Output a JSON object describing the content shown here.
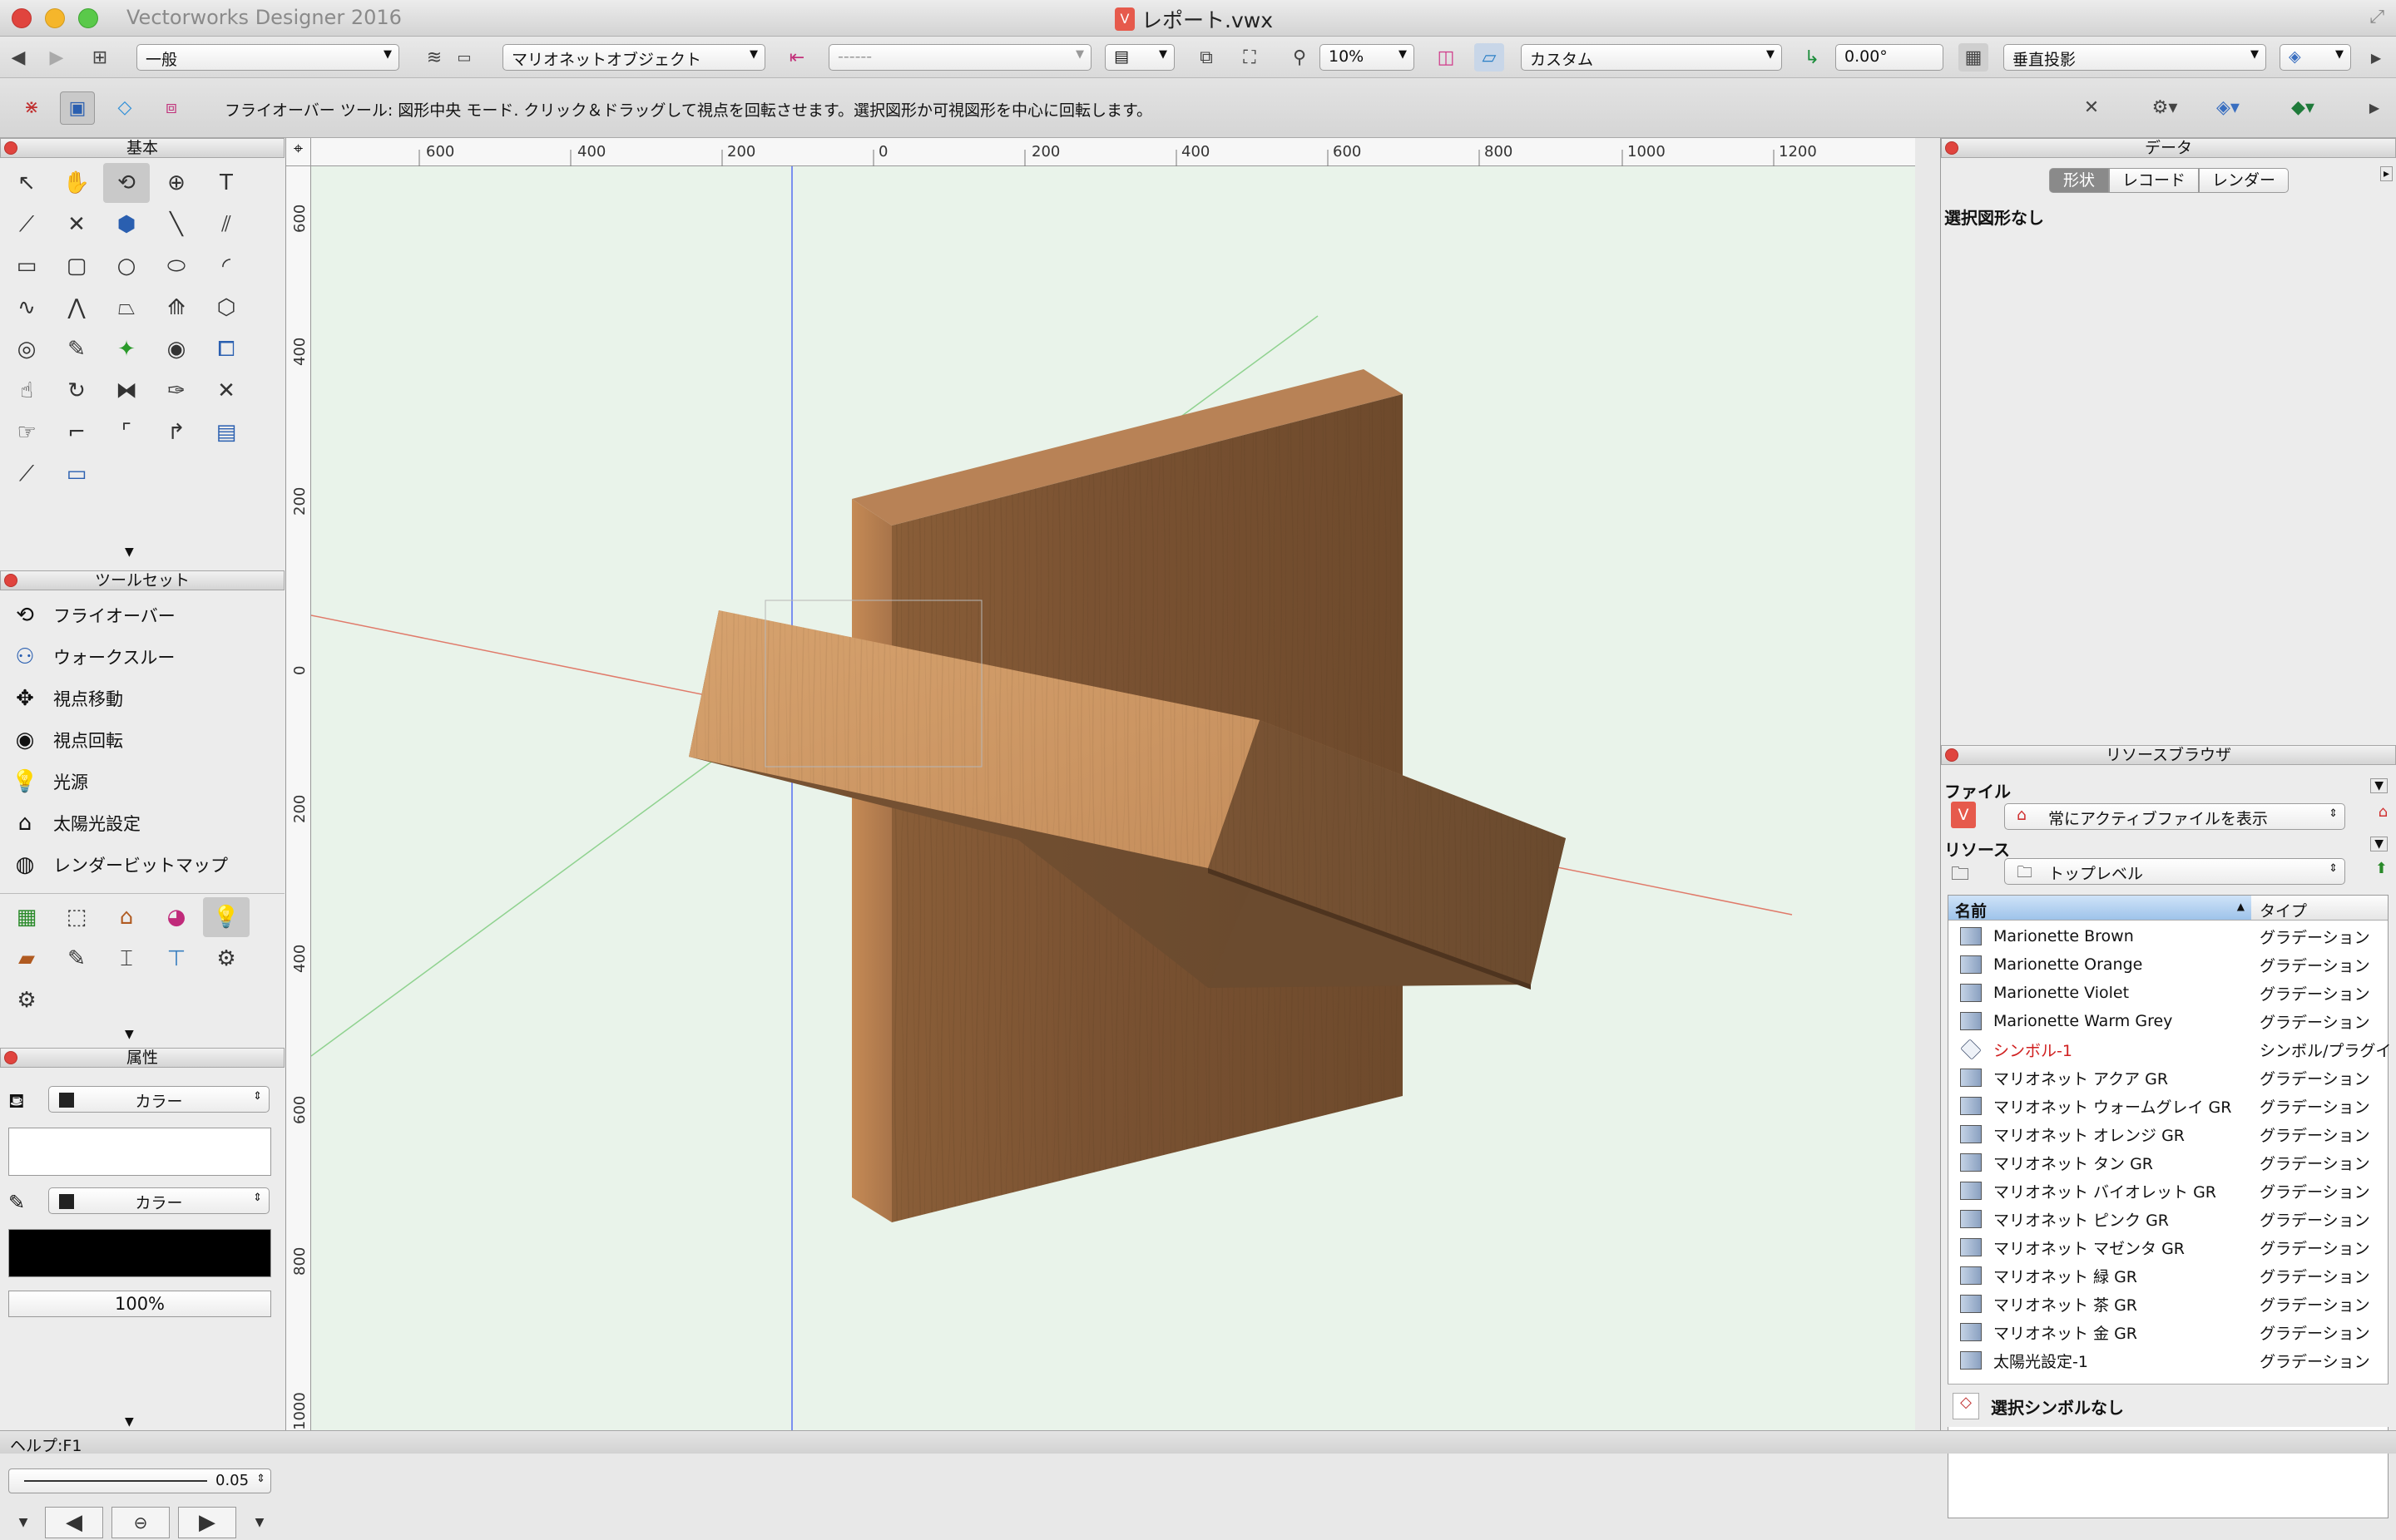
{
  "window": {
    "app_name": "Vectorworks Designer 2016",
    "doc_title": "レポート.vwx"
  },
  "toolbar1": {
    "class_select": "一般",
    "layer_select": "マリオネットオブジェクト",
    "sheet_select": "------",
    "zoom_value": "10%",
    "render_mode": "カスタム",
    "rotation_value": "0.00°",
    "view_select": "垂直投影"
  },
  "toolbar2": {
    "help_message": "フライオーバー ツール: 図形中央 モード. クリック＆ドラッグして視点を回転させます。選択図形か可視図形を中心に回転します。"
  },
  "palettes": {
    "basic": {
      "title": "基本"
    },
    "toolset": {
      "title": "ツールセット",
      "items": [
        {
          "label": "フライオーバー",
          "icon": "flyover-icon"
        },
        {
          "label": "ウォークスルー",
          "icon": "walkthrough-icon"
        },
        {
          "label": "視点移動",
          "icon": "pan-view-icon"
        },
        {
          "label": "視点回転",
          "icon": "rotate-view-icon"
        },
        {
          "label": "光源",
          "icon": "light-icon"
        },
        {
          "label": "太陽光設定",
          "icon": "sun-icon"
        },
        {
          "label": "レンダービットマップ",
          "icon": "render-bitmap-icon"
        }
      ]
    },
    "attributes": {
      "title": "属性",
      "fill_type": "カラー",
      "pen_type": "カラー",
      "opacity": "100%",
      "line_weight": "0.05"
    }
  },
  "rulers": {
    "h_labels": [
      "600",
      "400",
      "200",
      "0",
      "200",
      "400",
      "600",
      "800",
      "1000",
      "1200"
    ],
    "v_labels": [
      "600",
      "400",
      "200",
      "0",
      "200",
      "400",
      "600",
      "800",
      "1000"
    ]
  },
  "data_palette": {
    "title": "データ",
    "tabs": [
      "形状",
      "レコード",
      "レンダー"
    ],
    "active_tab": "形状",
    "selection_text": "選択図形なし"
  },
  "resource_browser": {
    "title": "リソースブラウザ",
    "file_label": "ファイル",
    "file_select": "常にアクティブファイルを表示",
    "resources_label": "リソース",
    "folder_select": "トップレベル",
    "col_name": "名前",
    "col_type": "タイプ",
    "rows": [
      {
        "name": "Marionette Brown",
        "type": "グラデーション"
      },
      {
        "name": "Marionette Orange",
        "type": "グラデーション"
      },
      {
        "name": "Marionette Violet",
        "type": "グラデーション"
      },
      {
        "name": "Marionette Warm Grey",
        "type": "グラデーション"
      },
      {
        "name": "シンボル-1",
        "type": "シンボル/プラグイ"
      },
      {
        "name": "マリオネット アクア GR",
        "type": "グラデーション"
      },
      {
        "name": "マリオネット ウォームグレイ GR",
        "type": "グラデーション"
      },
      {
        "name": "マリオネット オレンジ GR",
        "type": "グラデーション"
      },
      {
        "name": "マリオネット タン GR",
        "type": "グラデーション"
      },
      {
        "name": "マリオネット バイオレット GR",
        "type": "グラデーション"
      },
      {
        "name": "マリオネット ピンク GR",
        "type": "グラデーション"
      },
      {
        "name": "マリオネット マゼンタ GR",
        "type": "グラデーション"
      },
      {
        "name": "マリオネット 緑 GR",
        "type": "グラデーション"
      },
      {
        "name": "マリオネット 茶 GR",
        "type": "グラデーション"
      },
      {
        "name": "マリオネット 金 GR",
        "type": "グラデーション"
      },
      {
        "name": "太陽光設定-1",
        "type": "グラデーション"
      }
    ],
    "footer_text": "選択シンボルなし"
  },
  "statusbar": {
    "text": "ヘルプ:F1"
  }
}
